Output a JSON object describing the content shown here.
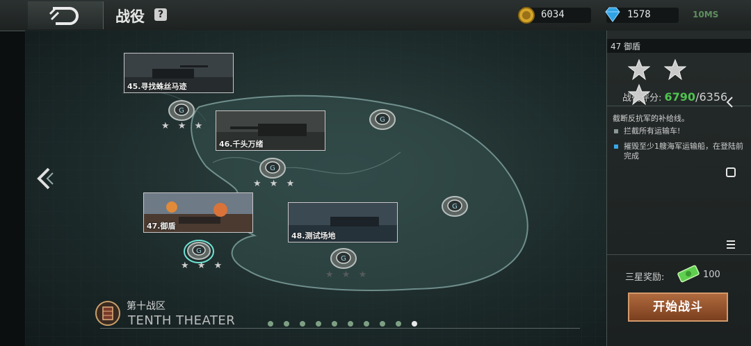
{
  "header": {
    "title": "战役",
    "help_label": "?",
    "gold": "6034",
    "diamonds": "1578",
    "status": "10MS"
  },
  "missions": [
    {
      "label": "45.寻找蛛丝马迹",
      "stars": "★ ★ ★"
    },
    {
      "label": "46.千头万绪",
      "stars": "★ ★ ★"
    },
    {
      "label": "47.御盾",
      "stars": "★ ★ ★"
    },
    {
      "label": "48.测试场地",
      "stars": "★ ★ ★"
    }
  ],
  "theater": {
    "name_cn": "第十战区",
    "name_en": "TENTH THEATER",
    "page_count": 10,
    "active_page": 10
  },
  "panel": {
    "mission_title": "47 御盾",
    "score_label": "战役评分:",
    "score_value": "6790",
    "score_separator": "/",
    "score_total": "6356",
    "description": "截断反抗军的补给线。",
    "objectives": [
      "拦截所有运输车!",
      "摧毁至少1艘海军运输船，在登陆前完成"
    ],
    "reward_label": "三星奖励:",
    "reward_value": "100",
    "start_button": "开始战斗"
  },
  "colors": {
    "score_accent": "#4fc24f",
    "button": "#9a552e",
    "gold": "#d4a52a",
    "diamond": "#2fa3e6"
  }
}
